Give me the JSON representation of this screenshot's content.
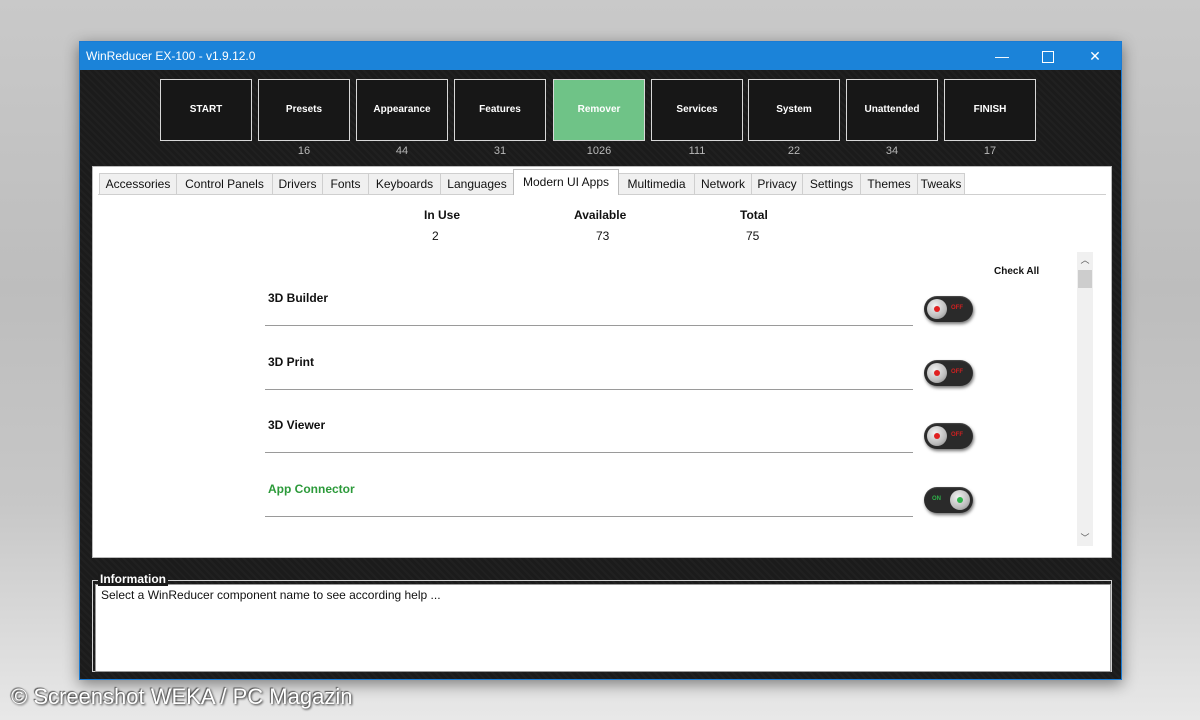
{
  "window": {
    "title": "WinReducer EX-100 - v1.9.12.0"
  },
  "wizard": {
    "steps": [
      {
        "label": "START",
        "count": ""
      },
      {
        "label": "Presets",
        "count": "16"
      },
      {
        "label": "Appearance",
        "count": "44"
      },
      {
        "label": "Features",
        "count": "31"
      },
      {
        "label": "Remover",
        "count": "1026"
      },
      {
        "label": "Services",
        "count": "111"
      },
      {
        "label": "System",
        "count": "22"
      },
      {
        "label": "Unattended",
        "count": "34"
      },
      {
        "label": "FINISH",
        "count": "17"
      }
    ],
    "active_step": "Remover",
    "active_color": "#6fc387"
  },
  "tabs": [
    "Accessories",
    "Control Panels",
    "Drivers",
    "Fonts",
    "Keyboards",
    "Languages",
    "Modern UI Apps",
    "Multimedia",
    "Network",
    "Privacy",
    "Settings",
    "Themes",
    "Tweaks"
  ],
  "active_tab": "Modern UI Apps",
  "stats": {
    "in_use_label": "In Use",
    "in_use_value": "2",
    "available_label": "Available",
    "available_value": "73",
    "total_label": "Total",
    "total_value": "75"
  },
  "check_all_label": "Check All",
  "apps": [
    {
      "name": "3D Builder",
      "state": "off",
      "toggle_text": "OFF"
    },
    {
      "name": "3D Print",
      "state": "off",
      "toggle_text": "OFF"
    },
    {
      "name": "3D Viewer",
      "state": "off",
      "toggle_text": "OFF"
    },
    {
      "name": "App Connector",
      "state": "on",
      "toggle_text": "ON"
    }
  ],
  "information": {
    "legend": "Information",
    "text": "Select a WinReducer component name to see according help ..."
  },
  "watermark": "© Screenshot WEKA / PC Magazin",
  "icons": {
    "minimize": "minimize-icon",
    "maximize": "maximize-icon",
    "close": "close-icon",
    "scroll_up": "chevron-up-icon",
    "scroll_down": "chevron-down-icon"
  }
}
